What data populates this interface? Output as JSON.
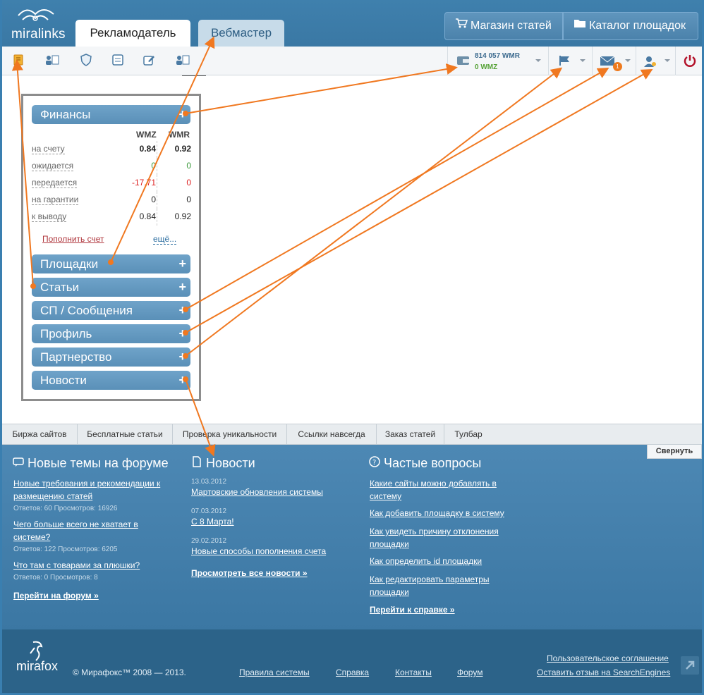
{
  "header": {
    "logo_text": "miralinks",
    "tabs": [
      {
        "label": "Рекламодатель"
      },
      {
        "label": "Вебмастер"
      }
    ],
    "buttons": {
      "shop": "Магазин статей",
      "catalog": "Каталог площадок"
    }
  },
  "toolbar": {
    "wallet": {
      "wmr": "814 057 WMR",
      "wmz": "0 WMZ"
    },
    "messages_badge": "1"
  },
  "finance": {
    "title": "Финансы",
    "col1": "WMZ",
    "col2": "WMR",
    "rows": [
      {
        "label": "на счету",
        "wmz": "0.84",
        "wmr": "0.92"
      },
      {
        "label": "ожидается",
        "wmz": "0",
        "wmr": "0"
      },
      {
        "label": "передается",
        "wmz": "-17.71",
        "wmr": "0"
      },
      {
        "label": "на гарантии",
        "wmz": "0",
        "wmr": "0"
      },
      {
        "label": "к выводу",
        "wmz": "0.84",
        "wmr": "0.92"
      }
    ],
    "topup": "Пополнить счет",
    "more": "ещё..."
  },
  "sections": [
    {
      "label": "Площадки"
    },
    {
      "label": "Статьи"
    },
    {
      "label": "СП / Сообщения"
    },
    {
      "label": "Профиль"
    },
    {
      "label": "Партнерство"
    },
    {
      "label": "Новости"
    }
  ],
  "plus": "+",
  "bottom_tabs": [
    {
      "label": "Биржа сайтов"
    },
    {
      "label": "Бесплатные статьи"
    },
    {
      "label": "Проверка уникальности"
    },
    {
      "label": "Ссылки навсегда"
    },
    {
      "label": "Заказ статей"
    },
    {
      "label": "Тулбар"
    }
  ],
  "collapse_label": "Свернуть",
  "forum": {
    "title": "Новые темы на форуме",
    "items": [
      {
        "title": "Новые требования и рекомендации к размещению статей",
        "meta": "Ответов: 60 Просмотров: 16926"
      },
      {
        "title": "Чего больше всего не хватает в системе?",
        "meta": "Ответов: 122 Просмотров: 6205"
      },
      {
        "title": "Что там с товарами за плюшки?",
        "meta": "Ответов: 0 Просмотров: 8"
      }
    ],
    "link": "Перейти на форум »"
  },
  "news": {
    "title": "Новости",
    "items": [
      {
        "date": "13.03.2012",
        "title": "Мартовские обновления системы"
      },
      {
        "date": "07.03.2012",
        "title": "С 8 Марта!"
      },
      {
        "date": "29.02.2012",
        "title": "Новые способы пополнения счета"
      }
    ],
    "link": "Просмотреть все новости »"
  },
  "faq": {
    "title": "Частые вопросы",
    "items": [
      {
        "title": "Какие сайты можно добавлять в систему"
      },
      {
        "title": "Как добавить площадку в систему"
      },
      {
        "title": "Как увидеть причину отклонения площадки"
      },
      {
        "title": "Как определить id площадки"
      },
      {
        "title": "Как редактировать параметры площадки"
      }
    ],
    "link": "Перейти к справке »"
  },
  "footer": {
    "logo_text": "mirafox",
    "copyright": "© Мирафокс™ 2008 — 2013.",
    "links": [
      "Правила системы",
      "Справка",
      "Контакты",
      "Форум"
    ],
    "agreement": "Пользовательское соглашение",
    "feedback": "Оставить отзыв на SearchEngines"
  },
  "colors": {
    "accent": "#3a78a4",
    "arrow": "#f07820",
    "section": "#5a90b8"
  }
}
